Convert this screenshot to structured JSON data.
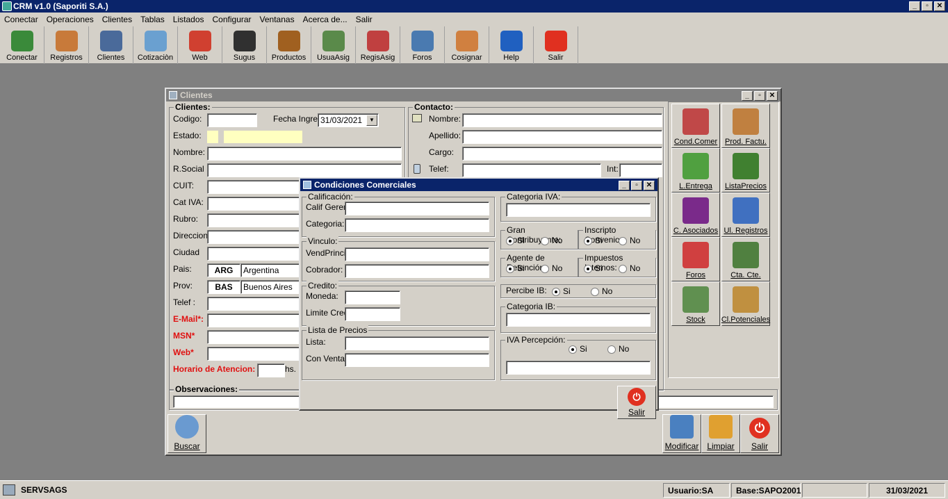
{
  "app": {
    "title": "CRM v1.0 (Saporiti S.A.)",
    "win_min": "_",
    "win_max": "▫",
    "win_close": "✕"
  },
  "menu": [
    "Conectar",
    "Operaciones",
    "Clientes",
    "Tablas",
    "Listados",
    "Configurar",
    "Ventanas",
    "Acerca de...",
    "Salir"
  ],
  "toolbar": [
    {
      "label": "Conectar",
      "icon": "connect-icon",
      "color": "#3a8a3a"
    },
    {
      "label": "Registros",
      "icon": "user-headset-icon",
      "color": "#c87a3a"
    },
    {
      "label": "Clientes",
      "icon": "person-icon",
      "color": "#4a6a9a"
    },
    {
      "label": "Cotizaciòn",
      "icon": "document-icon",
      "color": "#6aa0d0"
    },
    {
      "label": "Web",
      "icon": "calendar-icon",
      "color": "#d04030"
    },
    {
      "label": "Sugus",
      "icon": "spy-icon",
      "color": "#303030"
    },
    {
      "label": "Productos",
      "icon": "briefcase-icon",
      "color": "#a06020"
    },
    {
      "label": "UsuaAsig",
      "icon": "users-icon",
      "color": "#5a8a4a"
    },
    {
      "label": "RegisAsig",
      "icon": "register-icon",
      "color": "#c04040"
    },
    {
      "label": "Foros",
      "icon": "forum-icon",
      "color": "#4a7ab0"
    },
    {
      "label": "Cosignar",
      "icon": "woman-icon",
      "color": "#d08040"
    },
    {
      "label": "Help",
      "icon": "help-icon",
      "color": "#2060c0"
    },
    {
      "label": "Salir",
      "icon": "power-icon",
      "color": "#e03020"
    }
  ],
  "clientes": {
    "title": "Clientes",
    "section_clientes": "Clientes:",
    "section_contacto": "Contacto:",
    "codigo": "Codigo:",
    "fecha_ingre": "Fecha Ingre:",
    "fecha_value": "31/03/2021",
    "estado": "Estado:",
    "nombre": "Nombre:",
    "rsocial": "R.Social",
    "cuit": "CUIT:",
    "cativa": "Cat IVA:",
    "rubro": "Rubro:",
    "direccion": "Direccion:",
    "ciudad": "Ciudad",
    "pais": "Pais:",
    "pais_code": "ARG",
    "pais_name": "Argentina",
    "prov": "Prov:",
    "prov_code": "BAS",
    "prov_name": "Buenos Aires",
    "telef": "Telef :",
    "email": "E-Mail*:",
    "msn": "MSN*",
    "web": "Web*",
    "horario": "Horario de Atencion:",
    "hs": "hs.",
    "c_nombre": "Nombre:",
    "c_apellido": "Apellido:",
    "c_cargo": "Cargo:",
    "c_telef": "Telef:",
    "c_int": "Int:",
    "observaciones": "Observaciones:",
    "side_buttons": [
      {
        "label": "Cond.Comer",
        "icon": "cond-comer-icon",
        "color": "#c04848"
      },
      {
        "label": "Prod. Factu.",
        "icon": "prod-factu-icon",
        "color": "#c08040"
      },
      {
        "label": "L.Entrega",
        "icon": "box-entrega-icon",
        "color": "#50a040"
      },
      {
        "label": "ListaPrecios",
        "icon": "check-list-icon",
        "color": "#408030"
      },
      {
        "label": "C. Asociados",
        "icon": "window-list-icon",
        "color": "#7a2a8a"
      },
      {
        "label": "Ul. Registros",
        "icon": "stack-docs-icon",
        "color": "#4070c0"
      },
      {
        "label": "Foros",
        "icon": "pen-icon",
        "color": "#d04040"
      },
      {
        "label": "Cta. Cte.",
        "icon": "money-bag-icon",
        "color": "#508040"
      },
      {
        "label": "Stock",
        "icon": "stock-icon",
        "color": "#609050"
      },
      {
        "label": "Cl.Potenciales",
        "icon": "folder-people-icon",
        "color": "#c09040"
      }
    ],
    "buscar": "Buscar",
    "modificar": "Modificar",
    "limpiar": "Limpiar",
    "salir": "Salir"
  },
  "cond": {
    "title": "Condiciones Comerciales",
    "calificacion": "Calificación:",
    "calif_geren": "Calif Geren:",
    "categoria": "Categoria:",
    "vinculo": "Vinculo:",
    "vendprinci": "VendPrinci:",
    "cobrador": "Cobrador:",
    "credito": "Credito:",
    "moneda": "Moneda:",
    "limite_cred": "Limite Cred:",
    "lista_precios": "Lista de Precios",
    "lista": "Lista:",
    "con_venta": "Con Venta:",
    "categoria_iva": "Categoria IVA:",
    "gran_contrib": "Gran Contribuyente:",
    "inscripto": "Inscripto Convenio:",
    "agente_ret": "Agente de Retención:",
    "imp_internos": "Impuestos Internos:",
    "percibe_ib": "Percibe IB:",
    "categoria_ib": "Categoria IB:",
    "iva_percepcion": "IVA Percepción:",
    "si": "Si",
    "no": "No",
    "salir": "Salir"
  },
  "status": {
    "server": "SERVSAGS",
    "usuario": "Usuario:SA",
    "base": "Base:SAPO2001",
    "date": "31/03/2021"
  }
}
